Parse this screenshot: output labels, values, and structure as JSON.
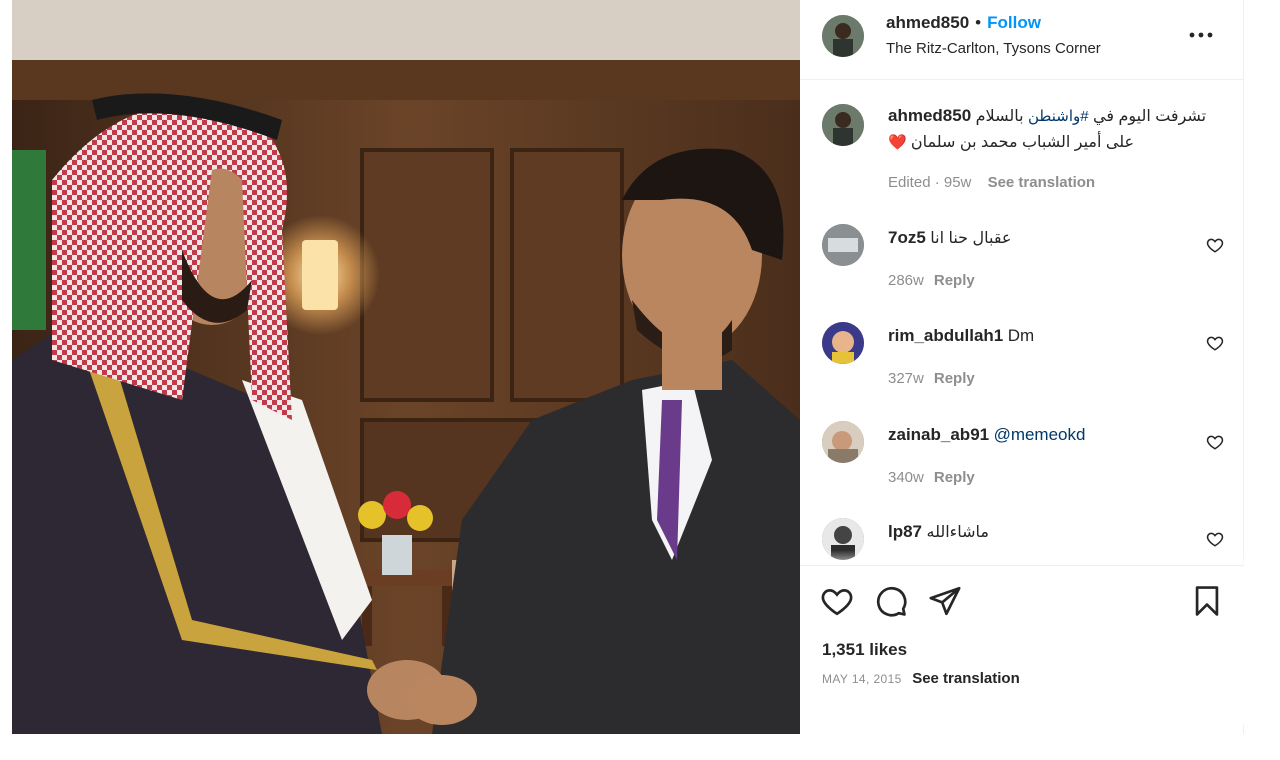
{
  "post": {
    "username": "ahmed850",
    "separator": "•",
    "follow_label": "Follow",
    "location": "The Ritz-Carlton, Tysons Corner"
  },
  "caption": {
    "username": "ahmed850",
    "text_prefix": "تشرفت اليوم في ",
    "hashtag": "#واشنطن",
    "text_middle": " بالسلام",
    "line2": "على أمير الشباب محمد بن سلمان",
    "heart": "❤️",
    "edited": "Edited · 95w",
    "see_translation": "See translation"
  },
  "comments": [
    {
      "username": "7oz5",
      "text": "عقبال حنا انا",
      "time": "286w",
      "reply": "Reply"
    },
    {
      "username": "rim_abdullah1",
      "text": "Dm",
      "time": "327w",
      "reply": "Reply"
    },
    {
      "username": "zainab_ab91",
      "mention": "@memeokd",
      "time": "340w",
      "reply": "Reply"
    },
    {
      "username": "lp87",
      "text": "ماشاءالله",
      "time": "",
      "reply": ""
    }
  ],
  "likes": "1,351 likes",
  "date": "MAY 14, 2015",
  "see_translation_2": "See translation",
  "colors": {
    "follow_blue": "#0095f6",
    "hashtag_blue": "#00376b",
    "meta_gray": "#8e8e8e",
    "heart_red": "#ed4956"
  },
  "icons": {
    "more": "more-horizontal-icon",
    "heart": "heart-icon",
    "comment": "comment-icon",
    "share": "send-icon",
    "save": "bookmark-icon"
  }
}
